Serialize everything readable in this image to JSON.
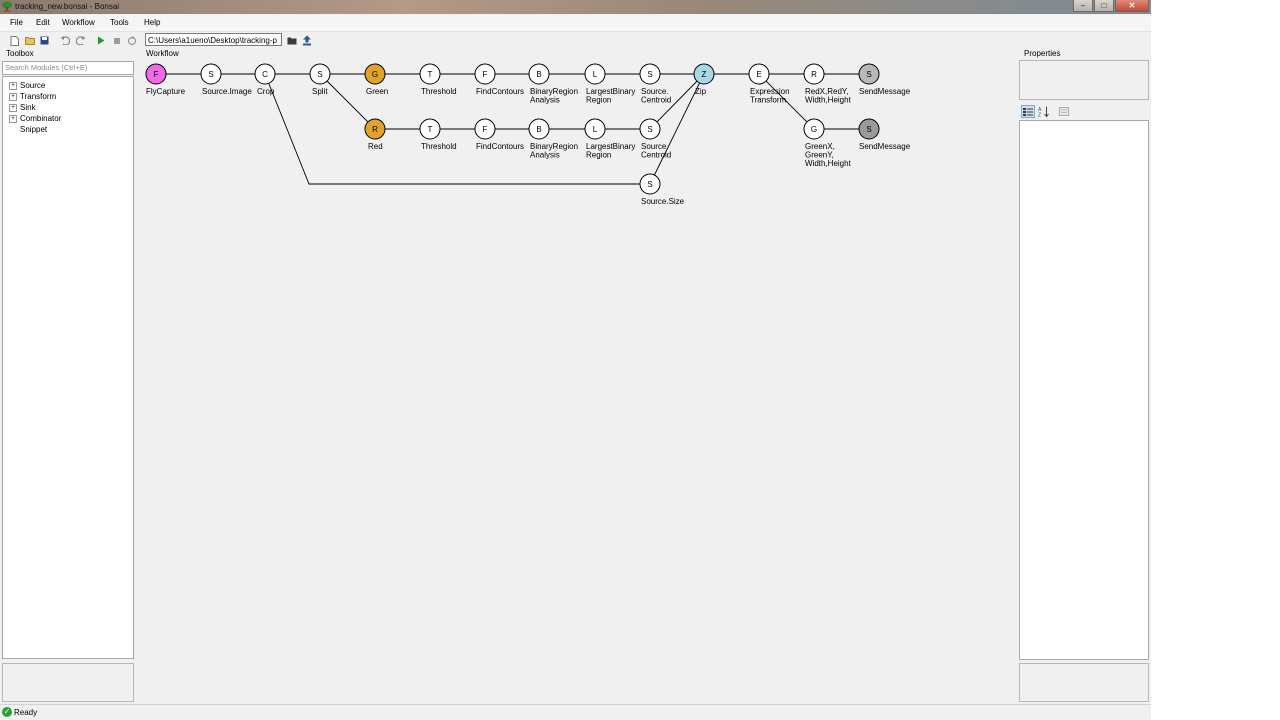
{
  "window": {
    "title": "tracking_new.bonsai - Bonsai",
    "buttons": [
      "–",
      "□",
      "✕"
    ]
  },
  "menu": [
    "File",
    "Edit",
    "Workflow",
    "Tools",
    "Help"
  ],
  "toolbar": {
    "path": "C:\\Users\\a1ueno\\Desktop\\tracking-p",
    "icons": [
      "new-file-icon",
      "open-folder-icon",
      "save-icon",
      "undo-icon",
      "redo-icon",
      "play-icon",
      "stop-icon",
      "restart-icon",
      "browse-folder-icon",
      "upload-icon"
    ]
  },
  "toolbox": {
    "title": "Toolbox",
    "search_placeholder": "Search Modules (Ctrl+E)",
    "items": [
      {
        "label": "Source",
        "expandable": true
      },
      {
        "label": "Transform",
        "expandable": true
      },
      {
        "label": "Sink",
        "expandable": true
      },
      {
        "label": "Combinator",
        "expandable": true
      },
      {
        "label": "Snippet",
        "expandable": false
      }
    ]
  },
  "workflow": {
    "title": "Workflow",
    "nodes": [
      {
        "id": "flycapture",
        "letter": "F",
        "label": [
          "FlyCapture"
        ],
        "color": "#f06ae8"
      },
      {
        "id": "source-image",
        "letter": "S",
        "label": [
          "Source.Image"
        ],
        "color": "#ffffff"
      },
      {
        "id": "crop",
        "letter": "C",
        "label": [
          "Crop"
        ],
        "color": "#ffffff"
      },
      {
        "id": "split",
        "letter": "S",
        "label": [
          "Split"
        ],
        "color": "#ffffff"
      },
      {
        "id": "green",
        "letter": "G",
        "label": [
          "Green"
        ],
        "color": "#e0a428"
      },
      {
        "id": "threshold-1",
        "letter": "T",
        "label": [
          "Threshold"
        ],
        "color": "#ffffff"
      },
      {
        "id": "findcontours-1",
        "letter": "F",
        "label": [
          "FindContours"
        ],
        "color": "#ffffff"
      },
      {
        "id": "binaryregion-1",
        "letter": "B",
        "label": [
          "BinaryRegion",
          "Analysis"
        ],
        "color": "#ffffff"
      },
      {
        "id": "largestbinary-1",
        "letter": "L",
        "label": [
          "LargestBinary",
          "Region"
        ],
        "color": "#ffffff"
      },
      {
        "id": "centroid-1",
        "letter": "S",
        "label": [
          "Source.",
          "Centroid"
        ],
        "color": "#ffffff"
      },
      {
        "id": "zip",
        "letter": "Z",
        "label": [
          "Zip"
        ],
        "color": "#a8d8e8"
      },
      {
        "id": "expression",
        "letter": "E",
        "label": [
          "Expression",
          "Transform"
        ],
        "color": "#ffffff"
      },
      {
        "id": "redxy",
        "letter": "R",
        "label": [
          "RedX,RedY,",
          "Width,Height"
        ],
        "color": "#ffffff"
      },
      {
        "id": "sendmessage-1",
        "letter": "S",
        "label": [
          "SendMessage"
        ],
        "color": "#b8b8b8"
      },
      {
        "id": "red",
        "letter": "R",
        "label": [
          "Red"
        ],
        "color": "#e0a428"
      },
      {
        "id": "threshold-2",
        "letter": "T",
        "label": [
          "Threshold"
        ],
        "color": "#ffffff"
      },
      {
        "id": "findcontours-2",
        "letter": "F",
        "label": [
          "FindContours"
        ],
        "color": "#ffffff"
      },
      {
        "id": "binaryregion-2",
        "letter": "B",
        "label": [
          "BinaryRegion",
          "Analysis"
        ],
        "color": "#ffffff"
      },
      {
        "id": "largestbinary-2",
        "letter": "L",
        "label": [
          "LargestBinary",
          "Region"
        ],
        "color": "#ffffff"
      },
      {
        "id": "centroid-2",
        "letter": "S",
        "label": [
          "Source.",
          "Centroid"
        ],
        "color": "#ffffff"
      },
      {
        "id": "greenxy",
        "letter": "G",
        "label": [
          "GreenX,",
          "GreenY,",
          "Width,Height"
        ],
        "color": "#ffffff"
      },
      {
        "id": "sendmessage-2",
        "letter": "S",
        "label": [
          "SendMessage"
        ],
        "color": "#9a9a9a"
      },
      {
        "id": "source-size",
        "letter": "S",
        "label": [
          "Source.Size"
        ],
        "color": "#ffffff"
      }
    ],
    "edges": [
      [
        "flycapture",
        "source-image"
      ],
      [
        "source-image",
        "crop"
      ],
      [
        "crop",
        "split"
      ],
      [
        "split",
        "green"
      ],
      [
        "green",
        "threshold-1"
      ],
      [
        "threshold-1",
        "findcontours-1"
      ],
      [
        "findcontours-1",
        "binaryregion-1"
      ],
      [
        "binaryregion-1",
        "largestbinary-1"
      ],
      [
        "largestbinary-1",
        "centroid-1"
      ],
      [
        "centroid-1",
        "zip"
      ],
      [
        "zip",
        "expression"
      ],
      [
        "expression",
        "redxy"
      ],
      [
        "redxy",
        "sendmessage-1"
      ],
      [
        "split",
        "red"
      ],
      [
        "red",
        "threshold-2"
      ],
      [
        "threshold-2",
        "findcontours-2"
      ],
      [
        "findcontours-2",
        "binaryregion-2"
      ],
      [
        "binaryregion-2",
        "largestbinary-2"
      ],
      [
        "largestbinary-2",
        "centroid-2"
      ],
      [
        "centroid-2",
        "zip"
      ],
      [
        "expression",
        "greenxy"
      ],
      [
        "greenxy",
        "sendmessage-2"
      ],
      [
        "crop",
        "source-size"
      ],
      [
        "source-size",
        "zip"
      ]
    ]
  },
  "properties": {
    "title": "Properties",
    "toolbar_icons": [
      "categorized-icon",
      "alphabetical-icon",
      "property-pages-icon"
    ]
  },
  "status": {
    "text": "Ready"
  }
}
